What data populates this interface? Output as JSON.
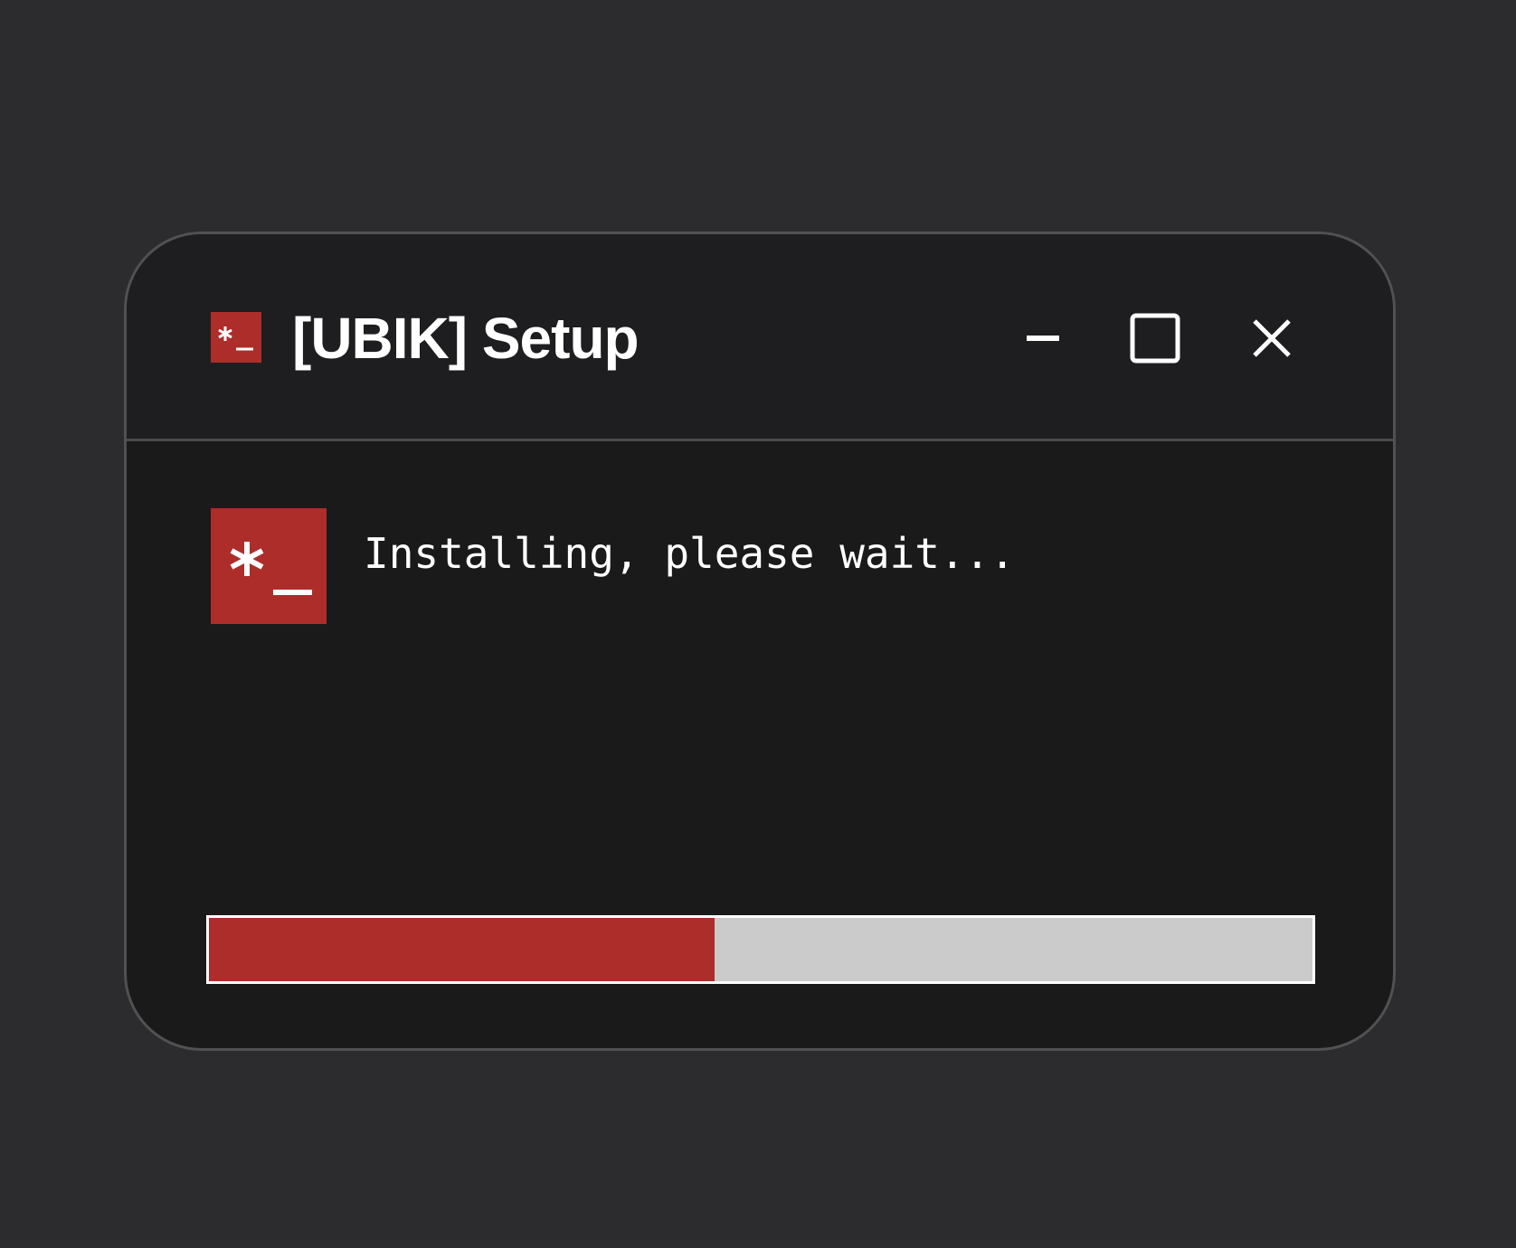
{
  "window": {
    "title": "[UBIK] Setup",
    "app_icon": "terminal-prompt-icon",
    "controls": {
      "minimize": "minimize-icon",
      "maximize": "maximize-icon",
      "close": "close-icon"
    }
  },
  "content": {
    "status_text": "Installing, please wait...",
    "progress_percent": 45.8
  },
  "colors": {
    "background": "#2c2c2f",
    "window": "#1a1a1b",
    "accent": "#ad2d2a",
    "progress_track": "#cbcbcb",
    "text": "#ffffff"
  }
}
